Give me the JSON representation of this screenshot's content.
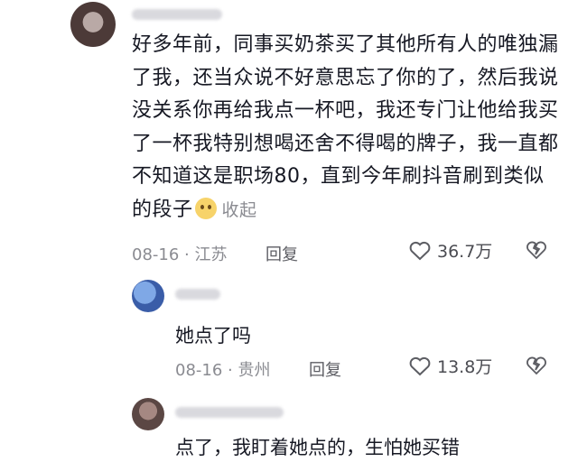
{
  "comment": {
    "text": "好多年前，同事买奶茶买了其他所有人的唯独漏了我，还当众说不好意思忘了你的了，然后我说没关系你再给我点一杯吧，我还专门让他给我买了一杯我特别想喝还舍不得喝的牌子，我一直都不知道这是职场80，直到今年刷抖音刷到类似的段子",
    "collapse_label": "收起",
    "date": "08-16",
    "location": "江苏",
    "reply_label": "回复",
    "likes": "36.7万"
  },
  "replies": [
    {
      "text": "她点了吗",
      "date": "08-16",
      "location": "贵州",
      "reply_label": "回复",
      "likes": "13.8万"
    },
    {
      "text": "点了，我盯着她点的，生怕她买错"
    }
  ],
  "colors": {
    "text": "#161823",
    "meta": "#8a8b91"
  }
}
